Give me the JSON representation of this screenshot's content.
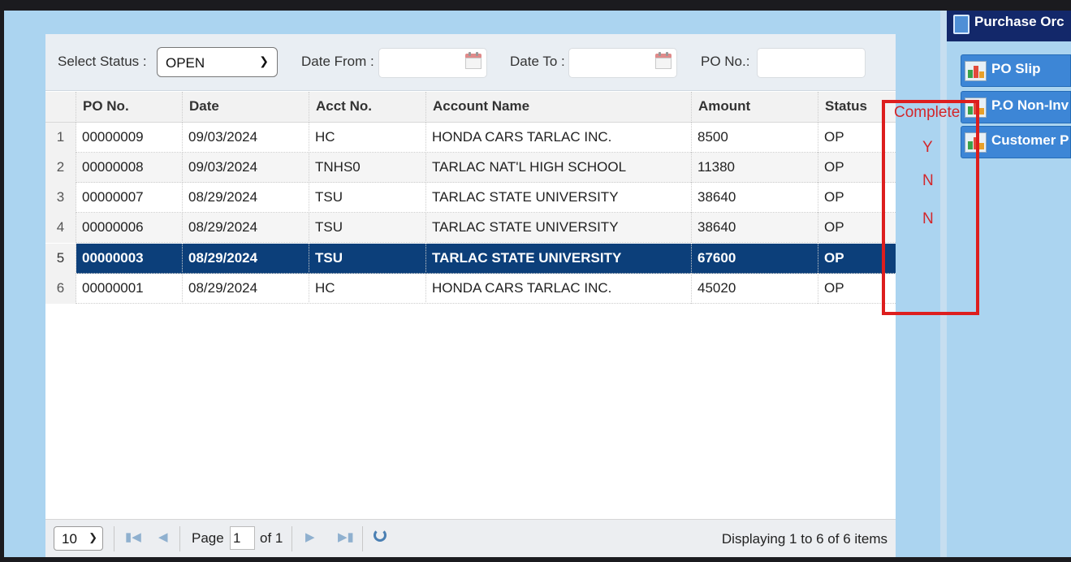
{
  "toolbar": {
    "status_label": "Select Status :",
    "status_value": "OPEN",
    "date_from_label": "Date From :",
    "date_from_value": "",
    "date_to_label": "Date To :",
    "date_to_value": "",
    "po_no_label": "PO No.:",
    "po_no_value": ""
  },
  "grid": {
    "columns": [
      "PO No.",
      "Date",
      "Acct No.",
      "Account Name",
      "Amount",
      "Status"
    ],
    "rows": [
      {
        "num": "1",
        "po_no": "00000009",
        "date": "09/03/2024",
        "acct_no": "HC",
        "account_name": "HONDA CARS TARLAC INC.",
        "amount": "8500",
        "status": "OP"
      },
      {
        "num": "2",
        "po_no": "00000008",
        "date": "09/03/2024",
        "acct_no": "TNHS0",
        "account_name": "TARLAC NAT'L HIGH SCHOOL",
        "amount": "11380",
        "status": "OP"
      },
      {
        "num": "3",
        "po_no": "00000007",
        "date": "08/29/2024",
        "acct_no": "TSU",
        "account_name": "TARLAC STATE UNIVERSITY",
        "amount": "38640",
        "status": "OP"
      },
      {
        "num": "4",
        "po_no": "00000006",
        "date": "08/29/2024",
        "acct_no": "TSU",
        "account_name": "TARLAC STATE UNIVERSITY",
        "amount": "38640",
        "status": "OP"
      },
      {
        "num": "5",
        "po_no": "00000003",
        "date": "08/29/2024",
        "acct_no": "TSU",
        "account_name": "TARLAC STATE UNIVERSITY",
        "amount": "67600",
        "status": "OP"
      },
      {
        "num": "6",
        "po_no": "00000001",
        "date": "08/29/2024",
        "acct_no": "HC",
        "account_name": "HONDA CARS TARLAC INC.",
        "amount": "45020",
        "status": "OP"
      }
    ],
    "selected_row": 5
  },
  "pager": {
    "page_size": "10",
    "page_label": "Page",
    "page_value": "1",
    "of_label": "of 1",
    "info": "Displaying 1 to 6 of 6 items"
  },
  "right_panel": {
    "title": "Purchase Orc",
    "buttons": [
      "PO Slip",
      "P.O Non-Inv",
      "Customer P"
    ]
  },
  "annotation": {
    "header": "Complete",
    "values": [
      "Y",
      "N",
      "N"
    ],
    "color": "#d3262a"
  },
  "colors": {
    "selected_row": "#0c3f7a",
    "panel_title": "#13286a",
    "panel_button": "#3d86d6",
    "background": "#abd4f0"
  },
  "icons": [
    "calendar-icon",
    "first-page-icon",
    "prev-page-icon",
    "next-page-icon",
    "last-page-icon",
    "refresh-icon",
    "report-chart-icon",
    "purchase-order-icon"
  ]
}
